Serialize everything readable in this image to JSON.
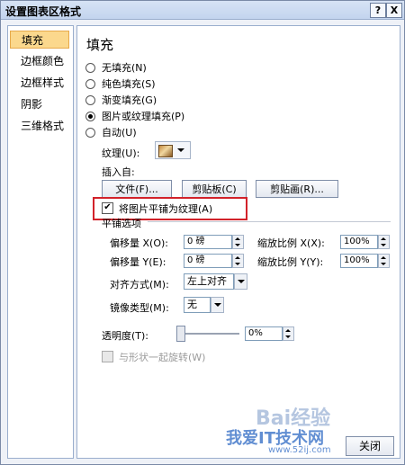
{
  "title": "设置图表区格式",
  "title_buttons": {
    "help": "?",
    "close": "X"
  },
  "sidebar": [
    "填充",
    "边框颜色",
    "边框样式",
    "阴影",
    "三维格式"
  ],
  "heading": "填充",
  "fill_options": [
    {
      "label": "无填充(N)"
    },
    {
      "label": "纯色填充(S)"
    },
    {
      "label": "渐变填充(G)"
    },
    {
      "label": "图片或纹理填充(P)"
    },
    {
      "label": "自动(U)"
    }
  ],
  "selected_fill_index": 3,
  "texture_label": "纹理(U):",
  "insert_from_label": "插入自:",
  "insert_buttons": [
    "文件(F)...",
    "剪贴板(C)",
    "剪贴画(R)..."
  ],
  "tile_checkbox": {
    "label": "将图片平铺为纹理(A)",
    "checked": true
  },
  "tile_options_label": "平铺选项",
  "offset_x": {
    "label": "偏移量 X(O):",
    "value": "0 磅"
  },
  "scale_x": {
    "label": "缩放比例 X(X):",
    "value": "100%"
  },
  "offset_y": {
    "label": "偏移量 Y(E):",
    "value": "0 磅"
  },
  "scale_y": {
    "label": "缩放比例 Y(Y):",
    "value": "100%"
  },
  "alignment": {
    "label": "对齐方式(M):",
    "value": "左上对齐"
  },
  "mirror": {
    "label": "镜像类型(M):",
    "value": "无"
  },
  "transparency": {
    "label": "透明度(T):",
    "value": "0%",
    "level": 0
  },
  "rotate_with_shape": {
    "label": "与形状一起旋转(W)",
    "enabled": false
  },
  "close_button": "关闭",
  "watermark": {
    "baidu": "Bai经验",
    "site": "我爱IT技术网",
    "url": "www.52ij.com"
  }
}
